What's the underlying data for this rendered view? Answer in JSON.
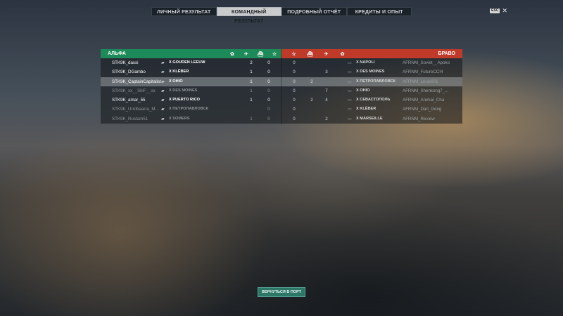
{
  "tabs": [
    {
      "label": "ЛИЧНЫЙ РЕЗУЛЬТАТ",
      "active": false
    },
    {
      "label": "КОМАНДНЫЙ РЕЗУЛЬТАТ",
      "active": true
    },
    {
      "label": "ПОДРОБНЫЙ ОТЧЁТ",
      "active": false
    },
    {
      "label": "КРЕДИТЫ И ОПЫТ",
      "active": false
    }
  ],
  "esc_label": "ESC",
  "close_glyph": "✕",
  "teams": {
    "left": {
      "name": "АЛЬФА",
      "color": "#1d8a5a"
    },
    "right": {
      "name": "БРАВО",
      "color": "#bf3a29"
    }
  },
  "header_icons": {
    "laurel": "laurel-icon",
    "plane": "plane-icon",
    "ship": "ship-icon",
    "star": "star-icon"
  },
  "left_rows": [
    {
      "player": "STK9K_dassi",
      "ship": "X GOUDEN LEEUW",
      "c1": "2",
      "c2": "0"
    },
    {
      "player": "STK9K_DGambo",
      "ship": "X KLÉBER",
      "c1": "1",
      "c2": "0"
    },
    {
      "player": "STK9K_CaptainCapitalist",
      "ship": "X OHIO",
      "c1": "1",
      "c2": "0"
    },
    {
      "player": "STK9K_xx__SkiF__xx",
      "ship": "X DES MOINES",
      "c1": "1",
      "c2": "0"
    },
    {
      "player": "STK9K_amar_55",
      "ship": "X PUERTO RICO",
      "c1": "1",
      "c2": "0"
    },
    {
      "player": "STK9K_Urrdbaarra_M...",
      "ship": "X ПЕТРОПАВЛОВСК",
      "c1": "",
      "c2": "0"
    },
    {
      "player": "STK9K_Rustam51",
      "ship": "X SOMERS",
      "c1": "1",
      "c2": "0"
    }
  ],
  "right_rows": [
    {
      "c1": "0",
      "c2": "",
      "c3": "",
      "ship": "X NAPOLI",
      "player": "AFRNM_Soviet__Apoko"
    },
    {
      "c1": "0",
      "c2": "",
      "c3": "3",
      "ship": "X DES MOINES",
      "player": "AFRNM_FutureCCI4"
    },
    {
      "c1": "0",
      "c2": "2",
      "c3": "",
      "ship": "X ПЕТРОПАВЛОВСК",
      "player": "AFRNM_Louis001"
    },
    {
      "c1": "0",
      "c2": "",
      "c3": "7",
      "ship": "X OHIO",
      "player": "AFRNM_Shenkong7_..."
    },
    {
      "c1": "0",
      "c2": "2",
      "c3": "4",
      "ship": "X СЕВАСТОПОЛЬ",
      "player": "AFRNM_Animal_Cha"
    },
    {
      "c1": "0",
      "c2": "",
      "c3": "",
      "ship": "X KLÉBER",
      "player": "AFRNM_Dan_Geng"
    },
    {
      "c1": "0",
      "c2": "",
      "c3": "2",
      "ship": "X MARSEILLE",
      "player": "AFRNM_Review"
    }
  ],
  "return_button": "ВЕРНУТЬСЯ В ПОРТ"
}
